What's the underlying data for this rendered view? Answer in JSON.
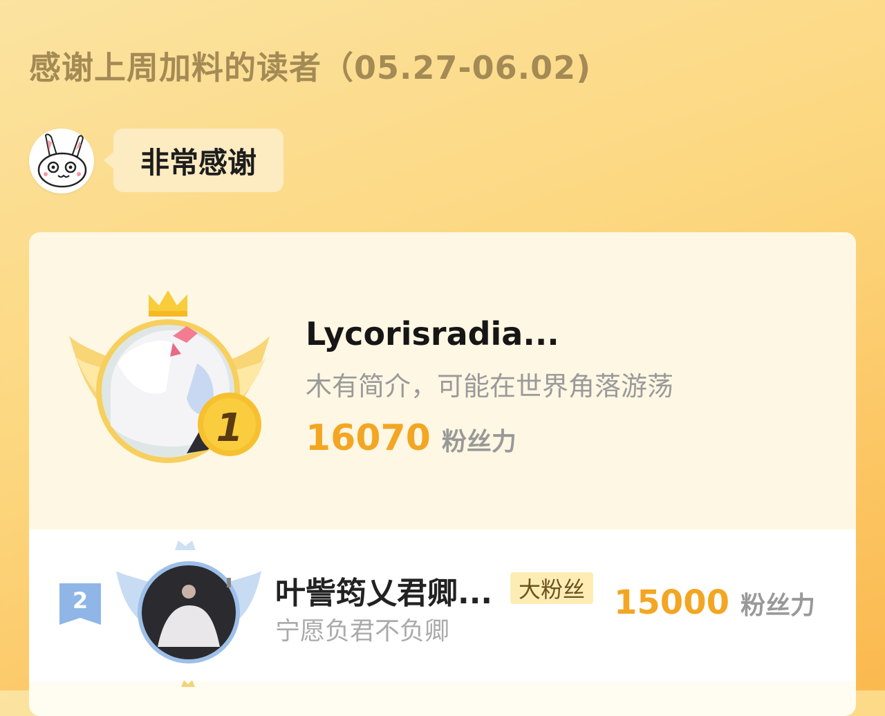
{
  "header": {
    "title": "感谢上周加料的读者（05.27-06.02)"
  },
  "thanks": {
    "mascot_icon": "bunny-mascot-icon",
    "bubble_text": "非常感谢"
  },
  "first_place": {
    "rank": "1",
    "name": "Lycorisradia...",
    "bio": "木有简介，可能在世界角落游荡",
    "score": "16070",
    "score_unit": "粉丝力",
    "crown_icon": "crown-icon"
  },
  "second_place": {
    "rank": "2",
    "name": "叶訾筠乂君卿...",
    "tag": "大粉丝",
    "bio": "宁愿负君不负卿",
    "score": "15000",
    "score_unit": "粉丝力"
  },
  "colors": {
    "accent_gold": "#f3a623",
    "rank2_blue": "#8fb6e6"
  }
}
